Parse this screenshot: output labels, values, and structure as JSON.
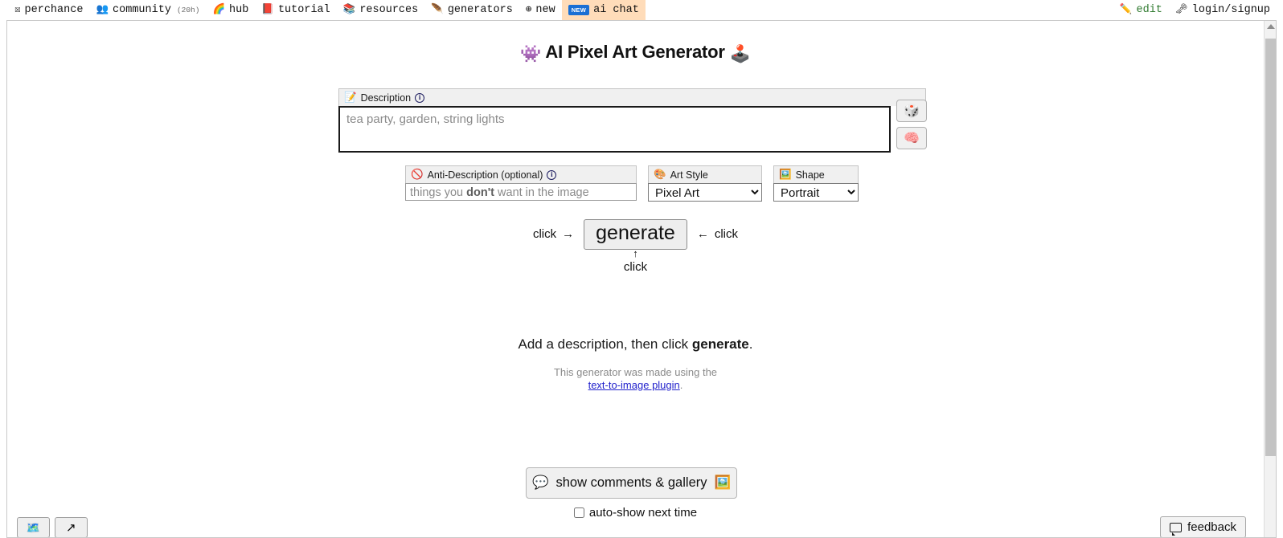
{
  "topnav": {
    "left_items": [
      {
        "icon": "perchance-logo-icon",
        "glyph": "☒",
        "label": "perchance",
        "sub": ""
      },
      {
        "icon": "people-icon",
        "glyph": "👥",
        "label": "community",
        "sub": "(20h)"
      },
      {
        "icon": "rainbow-icon",
        "glyph": "🌈",
        "label": "hub",
        "sub": ""
      },
      {
        "icon": "book-icon",
        "glyph": "📕",
        "label": "tutorial",
        "sub": ""
      },
      {
        "icon": "books-icon",
        "glyph": "📚",
        "label": "resources",
        "sub": ""
      },
      {
        "icon": "feather-icon",
        "glyph": "🪶",
        "label": "generators",
        "sub": ""
      },
      {
        "icon": "globe-icon",
        "glyph": "⊕",
        "label": "new",
        "sub": ""
      }
    ],
    "ai_chat": {
      "badge": "NEW",
      "label": "ai chat"
    },
    "right_items": [
      {
        "icon": "pencil-icon",
        "glyph": "✏️",
        "label": "edit"
      },
      {
        "icon": "key-icon",
        "glyph": "🗝",
        "label": "login/signup"
      }
    ]
  },
  "page": {
    "title": "AI Pixel Art Generator",
    "title_emoji_left": "👾",
    "title_emoji_right": "🕹️"
  },
  "description": {
    "label": "Description",
    "label_icon": "📝",
    "info_icon": "i",
    "placeholder": "tea party, garden, string lights",
    "value": ""
  },
  "side_buttons": [
    {
      "name": "randomize-button",
      "icon": "dice-icon",
      "glyph": "🎲"
    },
    {
      "name": "brainstorm-button",
      "icon": "brain-icon",
      "glyph": "🧠"
    }
  ],
  "anti_description": {
    "label": "Anti-Description (optional)",
    "label_icon": "🚫",
    "info_icon": "i",
    "placeholder_pre": "things you ",
    "placeholder_bold": "don't",
    "placeholder_post": " want in the image",
    "value": ""
  },
  "art_style": {
    "label": "Art Style",
    "label_icon": "🎨",
    "selected": "Pixel Art",
    "options": [
      "Pixel Art"
    ]
  },
  "shape": {
    "label": "Shape",
    "label_icon": "🖼️",
    "selected": "Portrait",
    "options": [
      "Portrait"
    ]
  },
  "generate": {
    "button_label": "generate",
    "hint_left": "click",
    "arrow_left": "→",
    "hint_right": "click",
    "arrow_right": "←",
    "arrow_up": "↑",
    "hint_below": "click"
  },
  "status": {
    "text_pre": "Add a description, then click ",
    "text_bold": "generate",
    "text_post": ".",
    "made_using": "This generator was made using the",
    "plugin_link": "text-to-image plugin",
    "plugin_period": "."
  },
  "comments": {
    "button_label": "show comments & gallery",
    "bubble_icon": "💬",
    "gallery_icon": "🖼️",
    "autoshow_label": "auto-show next time",
    "autoshow_checked": false
  },
  "bottom_left_buttons": [
    {
      "name": "page-map-button",
      "icon": "map-icon",
      "glyph": "🗺️"
    },
    {
      "name": "select-cursor-button",
      "icon": "cursor-arrow-icon",
      "glyph": "↖"
    }
  ],
  "feedback": {
    "label": "feedback",
    "icon": "speech-bubble-icon"
  }
}
